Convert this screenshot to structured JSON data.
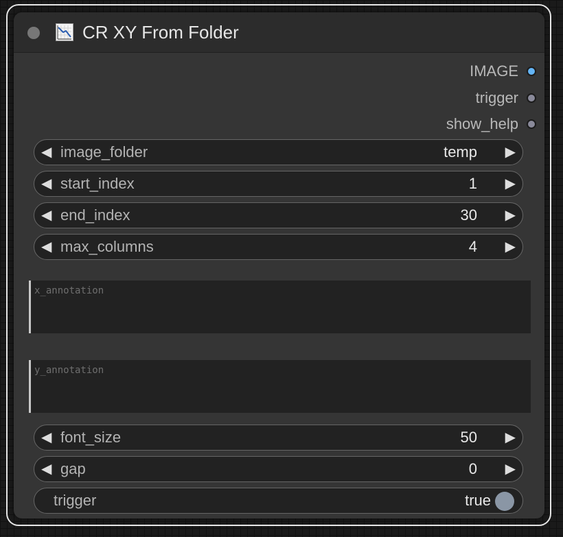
{
  "node": {
    "title": "CR XY From Folder",
    "title_icon": "chart-decreasing-icon",
    "outputs": [
      {
        "label": "IMAGE",
        "color": "#64b5f6"
      },
      {
        "label": "trigger",
        "color": "#8a8a9a"
      },
      {
        "label": "show_help",
        "color": "#8a8a9a"
      }
    ],
    "widgets": {
      "image_folder": {
        "label": "image_folder",
        "value": "temp"
      },
      "start_index": {
        "label": "start_index",
        "value": "1"
      },
      "end_index": {
        "label": "end_index",
        "value": "30"
      },
      "max_columns": {
        "label": "max_columns",
        "value": "4"
      },
      "x_annotation": {
        "placeholder": "x_annotation",
        "value": ""
      },
      "y_annotation": {
        "placeholder": "y_annotation",
        "value": ""
      },
      "font_size": {
        "label": "font_size",
        "value": "50"
      },
      "gap": {
        "label": "gap",
        "value": "0"
      },
      "trigger": {
        "label": "trigger",
        "value": "true"
      }
    }
  },
  "colors": {
    "node_body": "#353535",
    "node_header": "#2c2c2c",
    "widget_bg": "#222222",
    "selection_outline": "#e6e6e6"
  }
}
